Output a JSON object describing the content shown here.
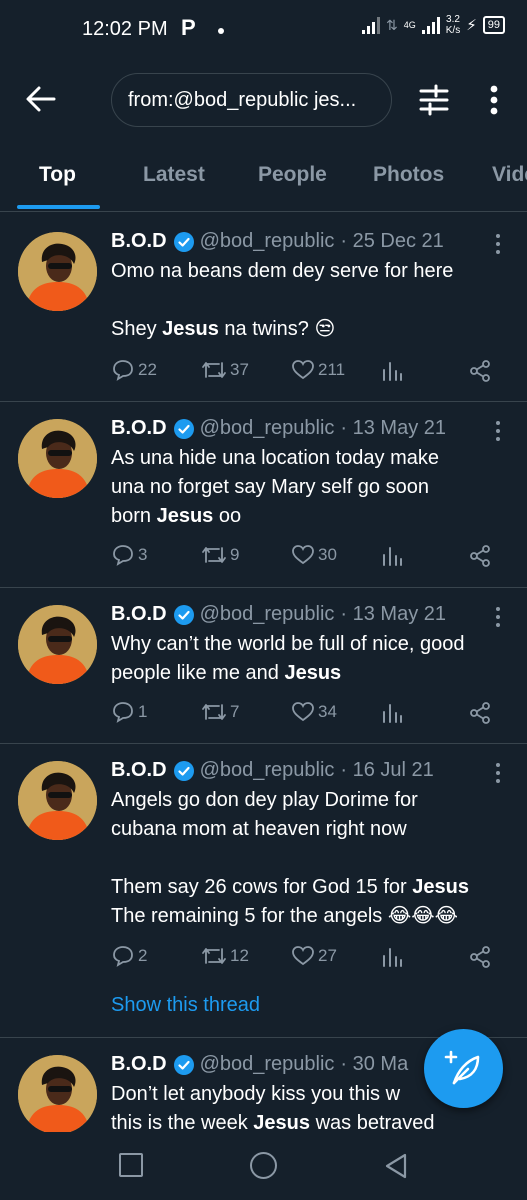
{
  "status_bar": {
    "time": "12:02 PM",
    "app_icon": "P",
    "network": "4G",
    "speed_value": "3.2",
    "speed_unit": "K/s",
    "battery": "99"
  },
  "top_bar": {
    "search_query": "from:@bod_republic jes..."
  },
  "tabs": [
    {
      "label": "Top",
      "active": true
    },
    {
      "label": "Latest",
      "active": false
    },
    {
      "label": "People",
      "active": false
    },
    {
      "label": "Photos",
      "active": false
    },
    {
      "label": "Vide",
      "active": false
    }
  ],
  "tweets": [
    {
      "name": "B.O.D",
      "handle": "@bod_republic",
      "date": "· 25 Dec 21",
      "line1": "Omo na beans dem dey serve for here",
      "line2_pre": "Shey ",
      "line2_bold": "Jesus",
      "line2_post": " na twins? 😒",
      "replies": "22",
      "retweets": "37",
      "likes": "211"
    },
    {
      "name": "B.O.D",
      "handle": "@bod_republic",
      "date": "· 13 May 21",
      "line1": "As una hide una location today make",
      "line2": "una no forget say Mary self go soon",
      "line3_pre": "born ",
      "line3_bold": "Jesus",
      "line3_post": " oo",
      "replies": "3",
      "retweets": "9",
      "likes": "30"
    },
    {
      "name": "B.O.D",
      "handle": "@bod_republic",
      "date": "· 13 May 21",
      "line1": "Why can’t the world be full of nice, good",
      "line2_pre": "people like me and ",
      "line2_bold": "Jesus",
      "replies": "1",
      "retweets": "7",
      "likes": "34"
    },
    {
      "name": "B.O.D",
      "handle": "@bod_republic",
      "date": "· 16 Jul 21",
      "line1": "Angels go don dey play Dorime for",
      "line2": "cubana mom at heaven right now",
      "line3_pre": "Them say 26 cows for God 15 for ",
      "line3_bold": "Jesus",
      "line4": "The remaining 5 for the angels 😂😂😂",
      "replies": "2",
      "retweets": "12",
      "likes": "27",
      "show_thread": "Show this thread"
    },
    {
      "name": "B.O.D",
      "handle": "@bod_republic",
      "date": "· 30 Ma",
      "line1": "Don’t let anybody kiss you this w",
      "line2_pre": "this is the week ",
      "line2_bold": "Jesus",
      "line2_post": " was betraved"
    }
  ],
  "icons": {
    "back": "arrow-left-icon",
    "filter": "sliders-icon",
    "more": "more-vertical-icon",
    "verified": "verified-badge-icon",
    "reply": "reply-icon",
    "retweet": "retweet-icon",
    "like": "heart-icon",
    "analytics": "analytics-icon",
    "share": "share-icon",
    "compose": "compose-tweet-icon"
  },
  "colors": {
    "background": "#15202b",
    "accent": "#1d9bf0",
    "muted_text": "#8b98a5",
    "divider": "#38444d"
  }
}
